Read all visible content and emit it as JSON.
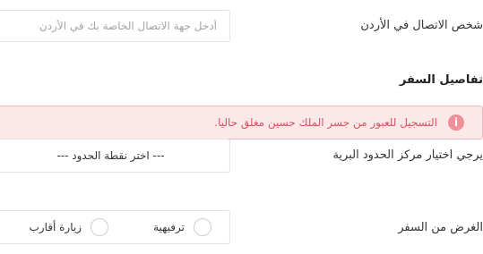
{
  "contact": {
    "label": "شخص الاتصال في الأردن",
    "placeholder": "أدخل جهة الاتصال الخاصة بك في الأردن"
  },
  "travel": {
    "section_title": "تفاصيل السفر",
    "alert_icon": "info-icon",
    "alert_text": "التسجيل للعبور من جسر الملك حسين مغلق حاليا.",
    "border_label": "يرجي اختيار مركز الحدود البرية",
    "border_select_value": "--- اختر نقطة الحدود ---",
    "purpose_label": "الغرض من السفر",
    "purpose_options": [
      {
        "label": "ترفيهية",
        "selected": false
      },
      {
        "label": "زيارة أقارب",
        "selected": false
      }
    ]
  },
  "colors": {
    "alert_bg": "#fbe9ea",
    "alert_border": "#f0b7bc",
    "alert_text": "#d6535e",
    "alert_icon": "#ef8f97"
  }
}
